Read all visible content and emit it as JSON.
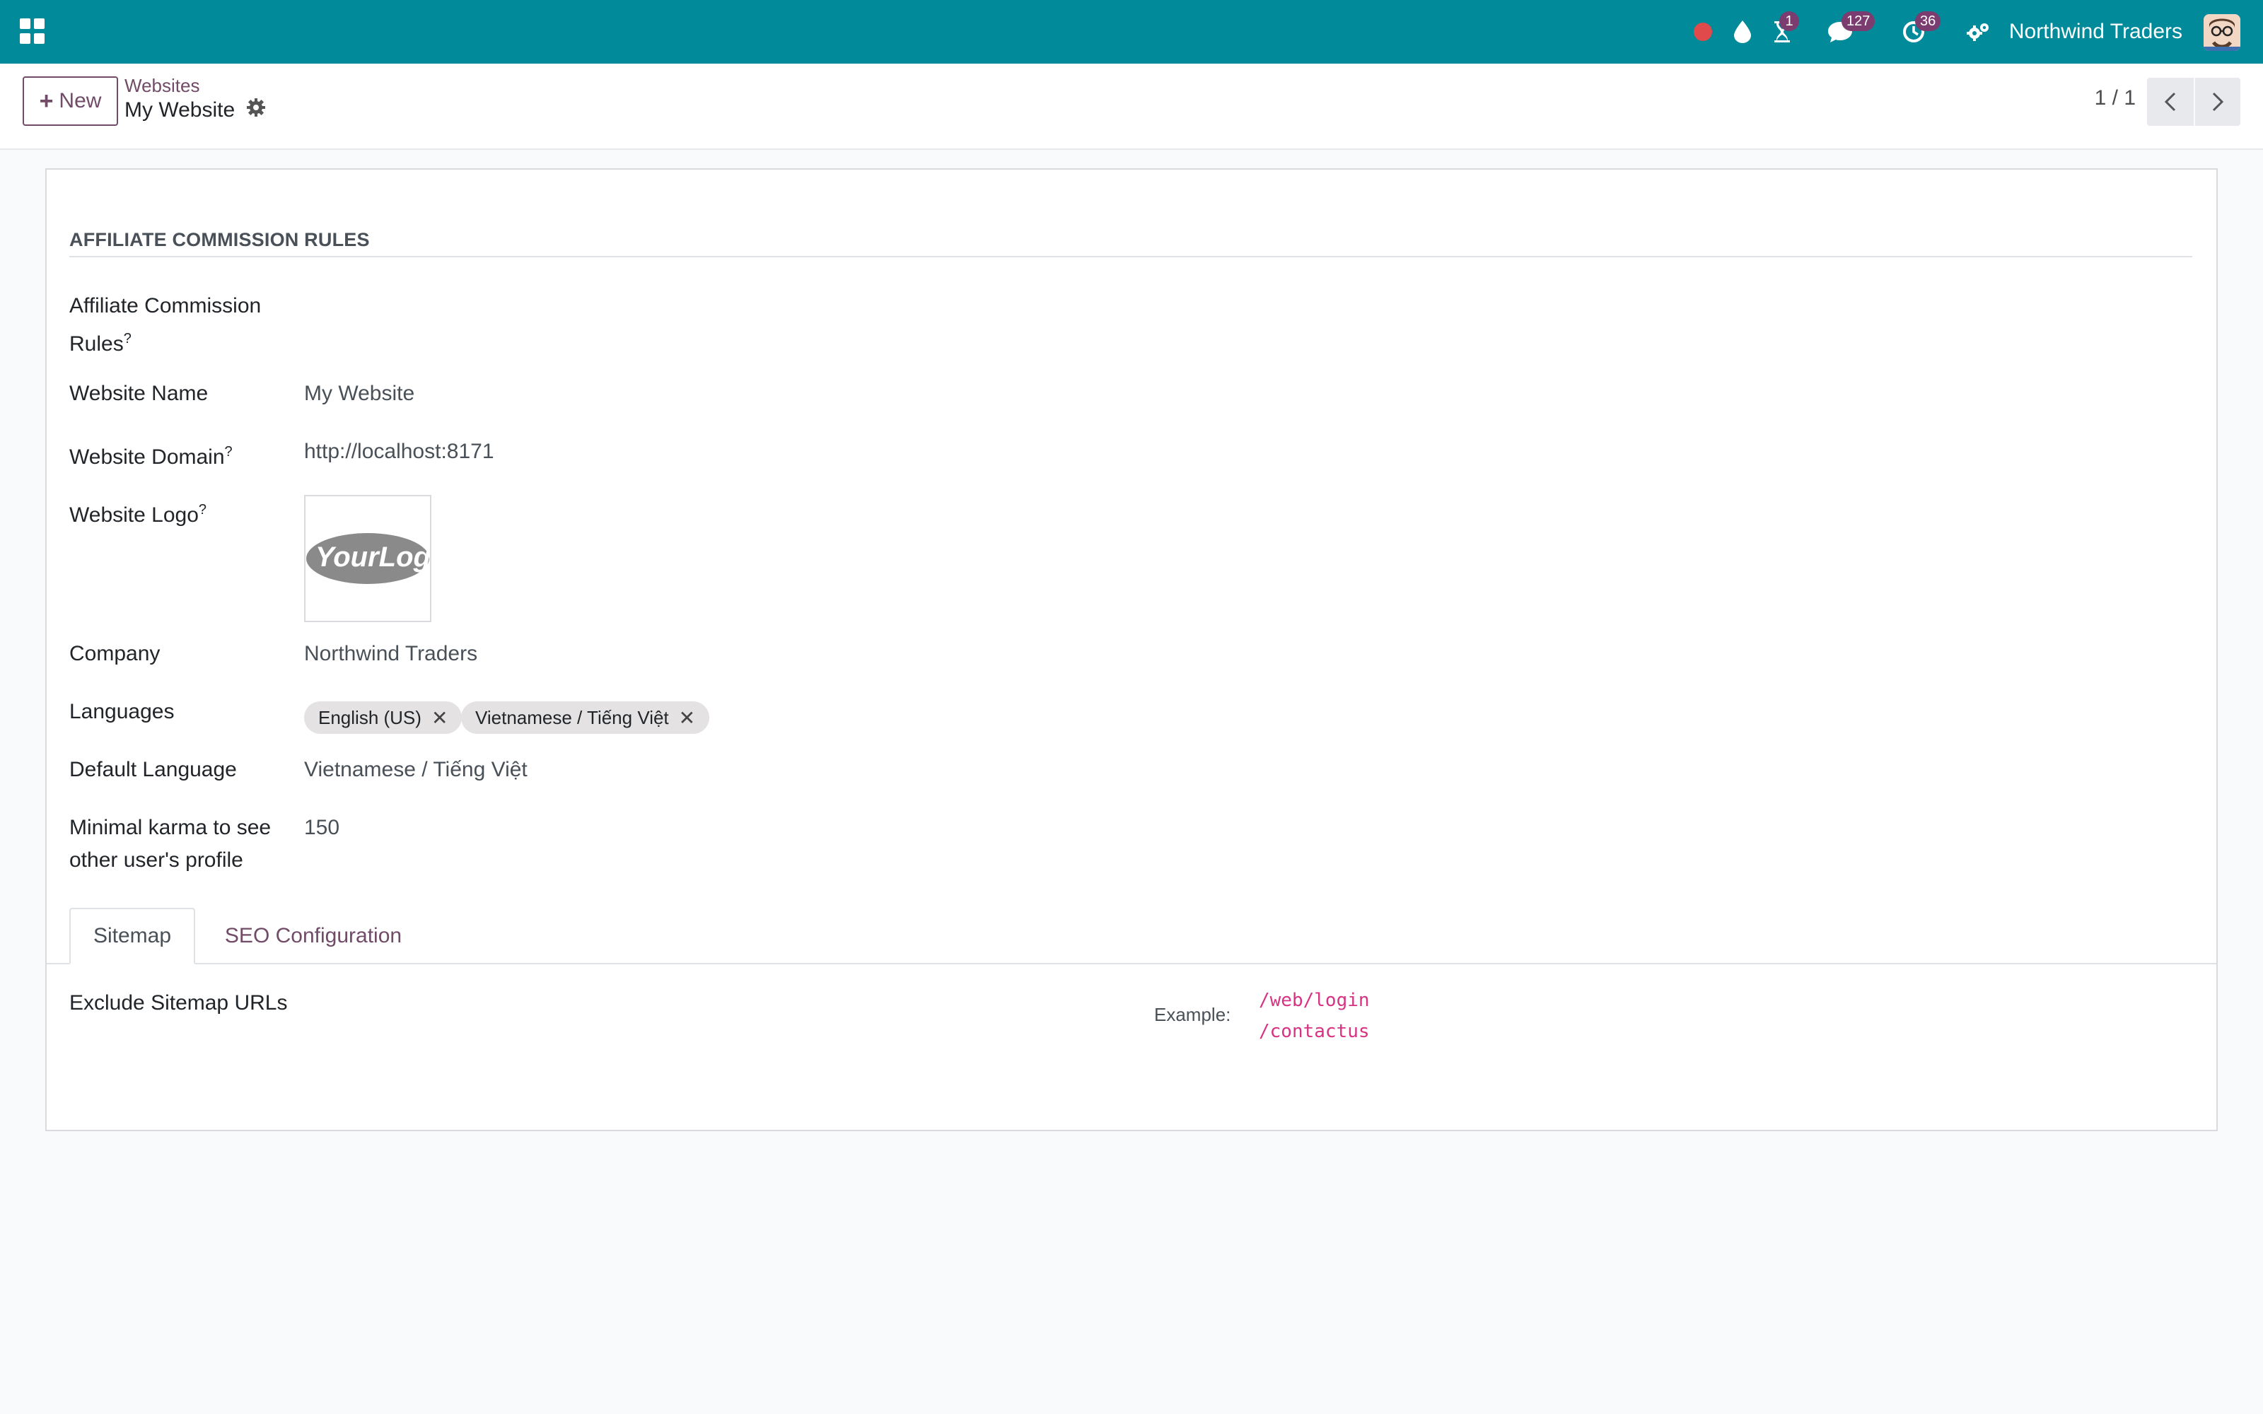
{
  "navbar": {
    "company": "Northwind Traders",
    "badges": {
      "activity": "1",
      "messages": "127",
      "clock": "36"
    }
  },
  "control_panel": {
    "new_label": "New",
    "breadcrumb": "Websites",
    "record_title": "My Website",
    "pager": "1 / 1"
  },
  "form": {
    "group_title": "AFFILIATE COMMISSION RULES",
    "fields": {
      "affiliate_label_1": "Affiliate Commission",
      "affiliate_label_2": "Rules",
      "website_name_label": "Website Name",
      "website_name_value": "My Website",
      "website_domain_label": "Website Domain",
      "website_domain_value": "http://localhost:8171",
      "website_logo_label": "Website Logo",
      "company_label": "Company",
      "company_value": "Northwind Traders",
      "languages_label": "Languages",
      "languages": [
        "English (US)",
        "Vietnamese / Tiếng Việt"
      ],
      "default_language_label": "Default Language",
      "default_language_value": "Vietnamese / Tiếng Việt",
      "karma_label_1": "Minimal karma to see",
      "karma_label_2": "other user's profile",
      "karma_value": "150",
      "help_mark": "?"
    },
    "logo_text": "YourLogo",
    "tabs": [
      "Sitemap",
      "SEO Configuration"
    ],
    "sitemap": {
      "label": "Exclude Sitemap URLs",
      "example_label": "Example:",
      "examples": [
        "/web/login",
        "/contactus"
      ]
    }
  },
  "colors": {
    "navbar": "#018a9a",
    "primary": "#714b67",
    "badge": "#7b3c6f",
    "code": "#d63384"
  }
}
